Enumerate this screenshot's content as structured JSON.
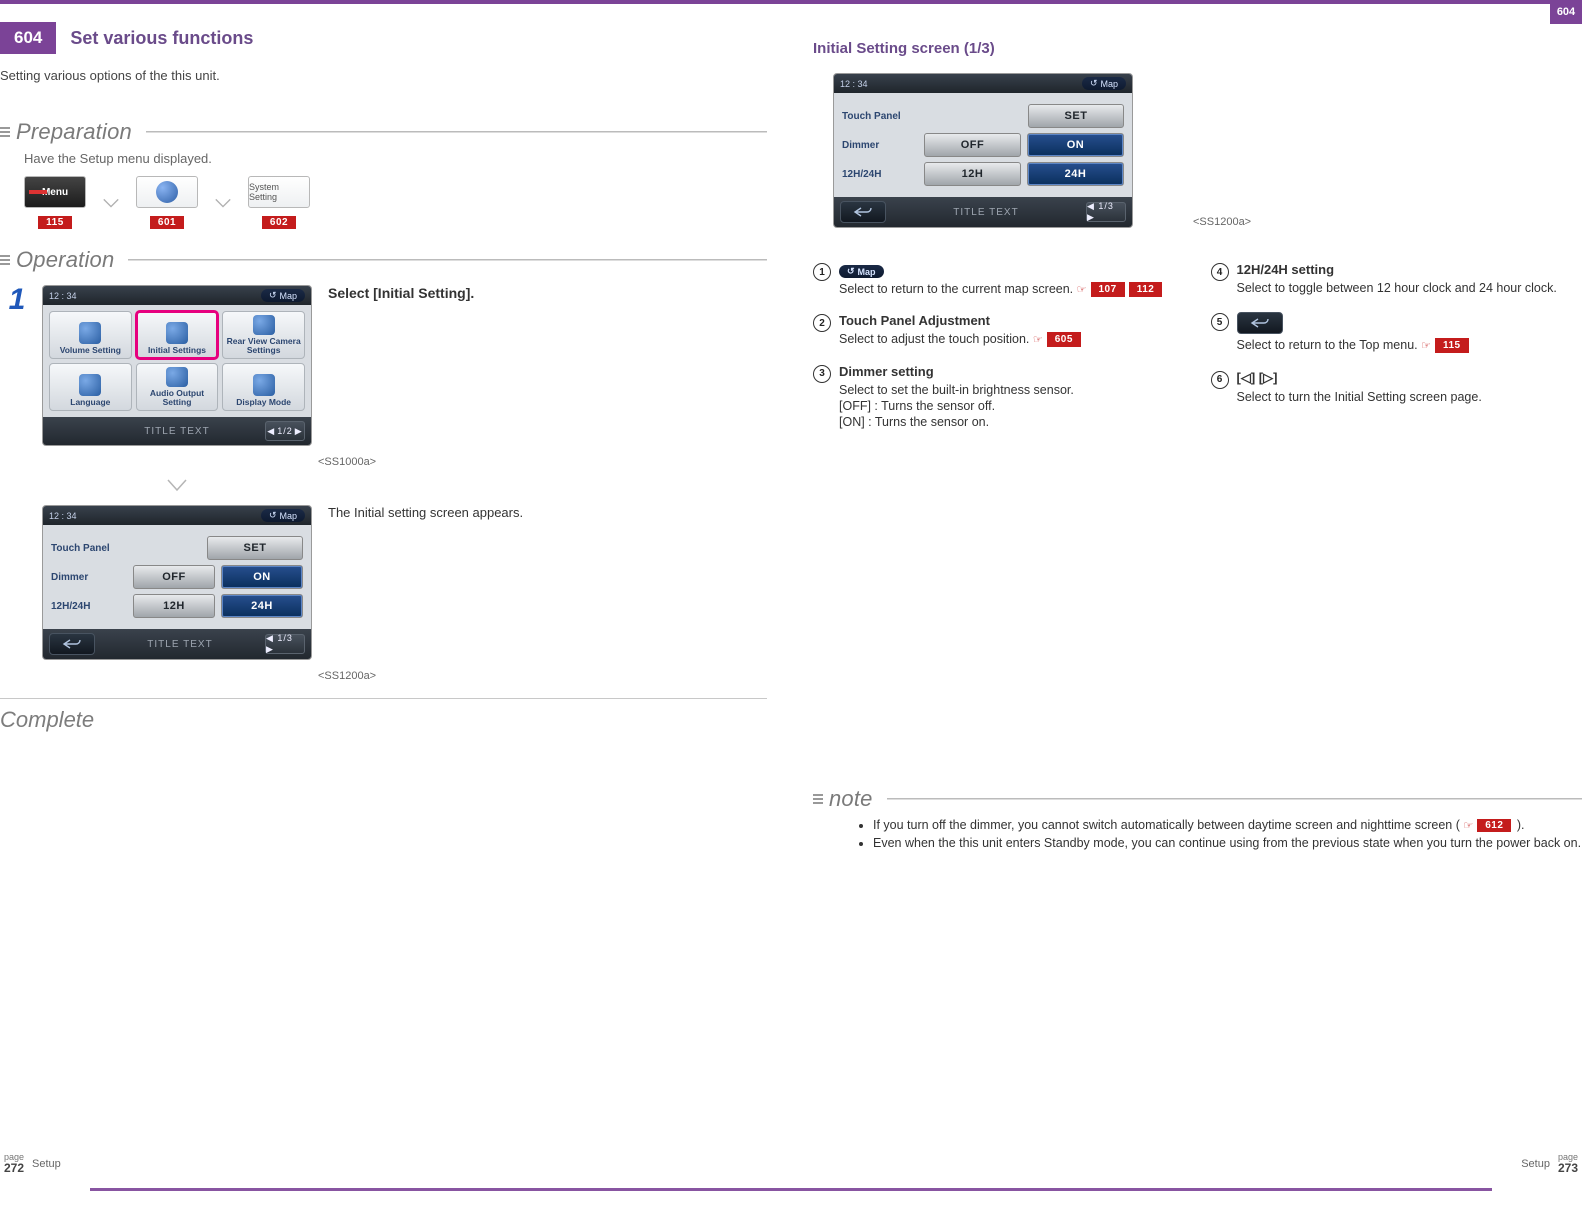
{
  "header": {
    "corner_page": "604",
    "badge_page": "604",
    "title": "Set various functions",
    "intro": "Setting various options of the this unit."
  },
  "preparation": {
    "heading": "Preparation",
    "desc": "Have the Setup menu displayed.",
    "thumbs": [
      {
        "label": "Menu",
        "ref": "115"
      },
      {
        "label": "",
        "ref": "601"
      },
      {
        "label": "System Setting",
        "ref": "602"
      }
    ]
  },
  "operation": {
    "heading": "Operation",
    "step_num": "1",
    "instruction": "Select [Initial Setting].",
    "menu_tiles": [
      "Volume Setting",
      "Initial Settings",
      "Rear View Camera Settings",
      "Language",
      "Audio Output Setting",
      "Display Mode"
    ],
    "menu_selected_index": 1,
    "title_text": "TITLE TEXT",
    "pager1": "1/2",
    "ss1": "<SS1000a>",
    "result_text": "The Initial setting screen appears.",
    "iset": {
      "time": "12 : 34",
      "map_label": "Map",
      "rows": [
        {
          "label": "Touch Panel",
          "buttons": [
            {
              "text": "SET",
              "sel": false,
              "single": true
            }
          ]
        },
        {
          "label": "Dimmer",
          "buttons": [
            {
              "text": "OFF",
              "sel": false
            },
            {
              "text": "ON",
              "sel": true
            }
          ]
        },
        {
          "label": "12H/24H",
          "buttons": [
            {
              "text": "12H",
              "sel": false
            },
            {
              "text": "24H",
              "sel": true
            }
          ]
        }
      ],
      "pager": "1/3"
    },
    "ss2": "<SS1200a>",
    "complete": "Complete"
  },
  "right": {
    "heading": "Initial Setting screen (1/3)",
    "ss": "<SS1200a>",
    "callouts": [
      "1",
      "2",
      "3",
      "4",
      "5",
      "6"
    ],
    "desc_left": [
      {
        "num": "1",
        "title_icon": true,
        "title": "Map",
        "text": "Select to return to the current map screen.",
        "refs": [
          "107",
          "112"
        ]
      },
      {
        "num": "2",
        "title": "Touch Panel Adjustment",
        "text": "Select to adjust the touch position.",
        "refs": [
          "605"
        ]
      },
      {
        "num": "3",
        "title": "Dimmer setting",
        "text": "Select to set the built-in brightness sensor.",
        "extra": [
          "[OFF] : Turns the sensor off.",
          "[ON] : Turns the sensor on."
        ]
      }
    ],
    "desc_right": [
      {
        "num": "4",
        "title": "12H/24H setting",
        "text": "Select to toggle between 12 hour clock and 24 hour clock."
      },
      {
        "num": "5",
        "title_back_icon": true,
        "text": "Select to return to the Top menu.",
        "refs": [
          "115"
        ]
      },
      {
        "num": "6",
        "title_nav": "[◁] [▷]",
        "text": "Select to turn the Initial Setting screen page."
      }
    ]
  },
  "note": {
    "heading": "note",
    "items": [
      {
        "text_a": "If you turn off the dimmer, you cannot switch automatically between daytime screen and nighttime screen ( ",
        "ref": "612",
        "text_b": " )."
      },
      {
        "text_a": "Even when the this unit enters Standby mode, you can continue using from the previous state when you turn the power back on."
      }
    ]
  },
  "footer": {
    "left_page": "272",
    "right_page": "273",
    "section": "Setup",
    "page_word": "page"
  }
}
